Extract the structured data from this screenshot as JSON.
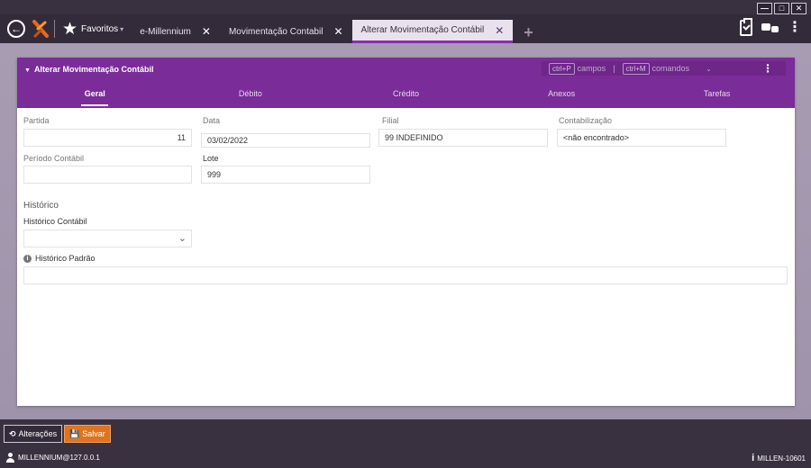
{
  "window": {
    "minimize_icon": "minimize-icon",
    "maximize_icon": "maximize-icon",
    "close_icon": "close-icon",
    "min_glyph": "—",
    "max_glyph": "□",
    "close_glyph": "✕"
  },
  "topbar": {
    "favorites_label": "Favoritos",
    "favorites_caret": "▾",
    "tabs": [
      {
        "label": "e-Millennium",
        "active": false
      },
      {
        "label": "Movimentação Contabil",
        "active": false
      },
      {
        "label": "Alterar Movimentação Contábil",
        "active": true
      }
    ],
    "add_tab": "+"
  },
  "form": {
    "title": "Alterar Movimentação Contábil",
    "shortcuts": {
      "campos_key": "ctrl+P",
      "campos_label": "campos",
      "pipe": "|",
      "comandos_key": "ctrl+M",
      "comandos_label": "comandos"
    },
    "section_tabs": [
      "Geral",
      "Débito",
      "Crédito",
      "Anexos",
      "Tarefas"
    ],
    "active_section": "Geral",
    "fields": {
      "partida": {
        "label": "Partida",
        "value": "11"
      },
      "data": {
        "label": "Data",
        "value": "03/02/2022"
      },
      "filial": {
        "label": "Filial",
        "value": "99 INDEFINIDO"
      },
      "contabilizacao": {
        "label": "Contabilização",
        "value": "<não encontrado>"
      },
      "periodo": {
        "label": "Período Contábil",
        "value": ""
      },
      "lote": {
        "label": "Lote",
        "value": "999"
      }
    },
    "historico": {
      "group_title": "Histórico",
      "contabil_label": "Histórico Contábil",
      "contabil_value": "",
      "padrao_label": "Histórico Padrão",
      "padrao_value": ""
    }
  },
  "actions": {
    "alteracoes_label": "Alterações",
    "salvar_label": "Salvar"
  },
  "status": {
    "user": "MILLENNIUM@127.0.0.1",
    "host": "MILLEN-10601"
  },
  "colors": {
    "accent": "#7a2c98",
    "save": "#e0741e",
    "chrome": "#342b3a"
  }
}
